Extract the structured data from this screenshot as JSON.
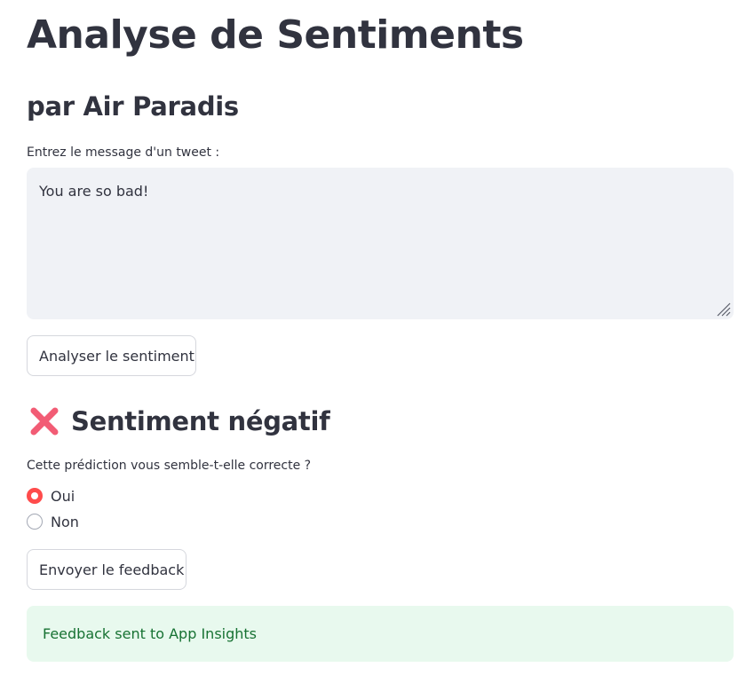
{
  "header": {
    "title": "Analyse de Sentiments",
    "subtitle": "par Air Paradis"
  },
  "tweet_input": {
    "label": "Entrez le message d'un tweet :",
    "value": "You are so bad!"
  },
  "analyse_button": {
    "label": "Analyser le sentiment"
  },
  "result": {
    "icon": "cross-mark-icon",
    "icon_color": "#f25c75",
    "text": "Sentiment négatif"
  },
  "feedback": {
    "question": "Cette prédiction vous semble-t-elle correcte ?",
    "options": [
      {
        "label": "Oui",
        "selected": true
      },
      {
        "label": "Non",
        "selected": false
      }
    ],
    "accent_color": "#ff4b4b",
    "submit_label": "Envoyer le feedback",
    "success_message": "Feedback sent to App Insights",
    "success_bg": "#e8f9ee",
    "success_text_color": "#177233"
  }
}
